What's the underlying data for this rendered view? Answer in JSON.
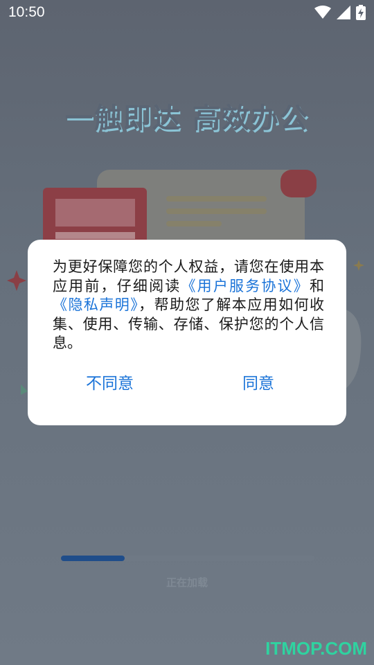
{
  "status_bar": {
    "time": "10:50",
    "icons": [
      "wifi-icon",
      "signal-icon",
      "battery-charging-icon"
    ]
  },
  "splash": {
    "headline": "一触即达 高效办公",
    "loading_text": "正在加载",
    "progress": 0.25
  },
  "dialog": {
    "text_before_link1": "为更好保障您的个人权益，请您在使用本应用前，仔细阅读",
    "link_terms": "《用户服务协议》",
    "text_and": "和",
    "link_privacy": "《隐私声明》",
    "text_after": "，帮助您了解本应用如何收集、使用、传输、存储、保护您的个人信息。",
    "disagree_label": "不同意",
    "agree_label": "同意"
  },
  "watermark": "ITMOP.COM",
  "colors": {
    "link": "#1a73d8",
    "dialog_bg": "#ffffff",
    "overlay": "#66707c",
    "watermark": "#2fd3a0"
  }
}
